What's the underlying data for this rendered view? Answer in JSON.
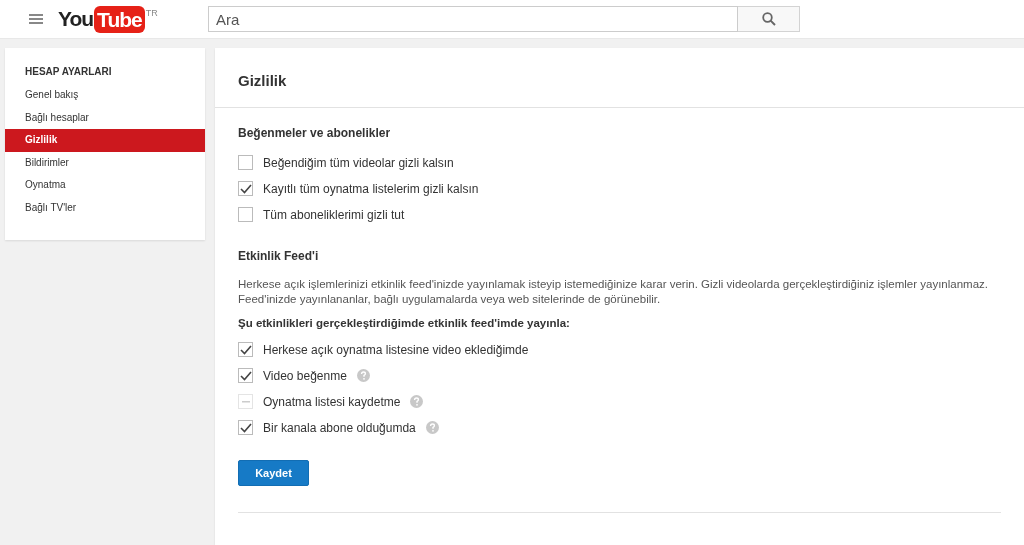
{
  "header": {
    "logo": {
      "you": "You",
      "tube": "Tube",
      "region": "TR"
    },
    "search": {
      "placeholder": "Ara"
    }
  },
  "sidebar": {
    "heading": "HESAP AYARLARI",
    "items": [
      {
        "label": "Genel bakış",
        "selected": false
      },
      {
        "label": "Bağlı hesaplar",
        "selected": false
      },
      {
        "label": "Gizlilik",
        "selected": true
      },
      {
        "label": "Bildirimler",
        "selected": false
      },
      {
        "label": "Oynatma",
        "selected": false
      },
      {
        "label": "Bağlı TV'ler",
        "selected": false
      }
    ]
  },
  "page": {
    "title": "Gizlilik",
    "likes_section": {
      "heading": "Beğenmeler ve abonelikler",
      "options": [
        {
          "label": "Beğendiğim tüm videolar gizli kalsın",
          "checked": false
        },
        {
          "label": "Kayıtlı tüm oynatma listelerim gizli kalsın",
          "checked": true
        },
        {
          "label": "Tüm aboneliklerimi gizli tut",
          "checked": false
        }
      ]
    },
    "feed_section": {
      "heading": "Etkinlik Feed'i",
      "description": "Herkese açık işlemlerinizi etkinlik feed'inizde yayınlamak isteyip istemediğinize karar verin. Gizli videolarda gerçekleştirdiğiniz işlemler yayınlanmaz. Feed'inizde yayınlananlar, bağlı uygulamalarda veya web sitelerinde de görünebilir.",
      "subheading": "Şu etkinlikleri gerçekleştirdiğimde etkinlik feed'imde yayınla:",
      "options": [
        {
          "label": "Herkese açık oynatma listesine video eklediğimde",
          "checked": true,
          "disabled": false,
          "help": false
        },
        {
          "label": "Video beğenme",
          "checked": true,
          "disabled": false,
          "help": true
        },
        {
          "label": "Oynatma listesi kaydetme",
          "checked": false,
          "disabled": true,
          "help": true
        },
        {
          "label": "Bir kanala abone olduğumda",
          "checked": true,
          "disabled": false,
          "help": true
        }
      ]
    },
    "save_button": "Kaydet"
  }
}
